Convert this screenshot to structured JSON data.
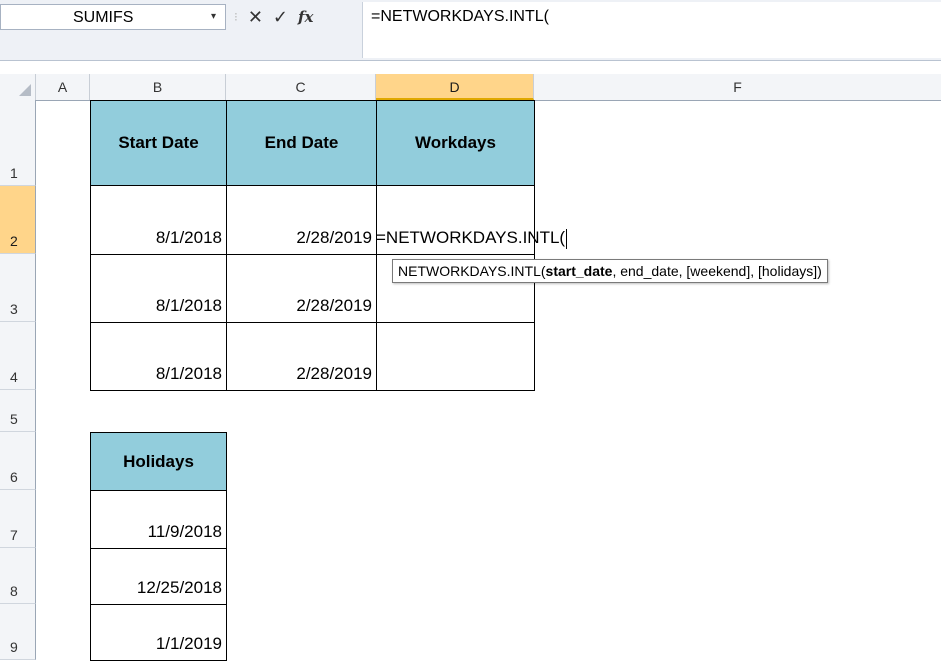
{
  "formula_bar": {
    "name_box": "SUMIFS",
    "name_box_dropdown": "▾",
    "cancel_icon": "✕",
    "enter_icon": "✓",
    "fx_label": "fx",
    "formula": "=NETWORKDAYS.INTL("
  },
  "columns": [
    "A",
    "B",
    "C",
    "D",
    "F"
  ],
  "rows": [
    "1",
    "2",
    "3",
    "4",
    "5",
    "6",
    "7",
    "8",
    "9"
  ],
  "table1": {
    "headers": [
      "Start Date",
      "End Date",
      "Workdays"
    ],
    "rows": [
      {
        "start": "8/1/2018",
        "end": "2/28/2019"
      },
      {
        "start": "8/1/2018",
        "end": "2/28/2019"
      },
      {
        "start": "8/1/2018",
        "end": "2/28/2019"
      }
    ]
  },
  "editing_cell": "=NETWORKDAYS.INTL(",
  "tooltip": {
    "func": "NETWORKDAYS.INTL(",
    "arg_active": "start_date",
    "rest": ", end_date, [weekend], [holidays])"
  },
  "holidays": {
    "header": "Holidays",
    "values": [
      "11/9/2018",
      "12/25/2018",
      "1/1/2019"
    ]
  },
  "colors": {
    "header_fill": "#92cddc",
    "active_header": "#ffd58a"
  }
}
